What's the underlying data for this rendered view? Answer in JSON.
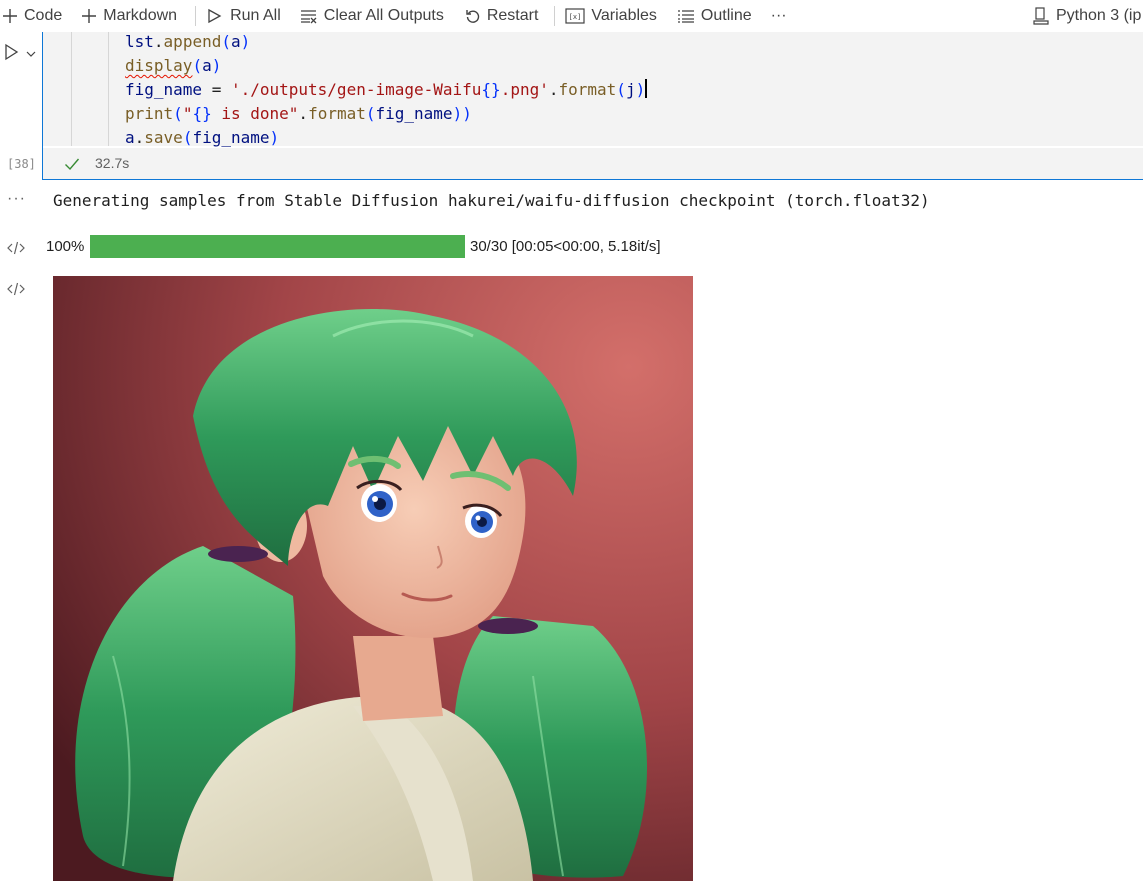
{
  "toolbar": {
    "code_label": "Code",
    "markdown_label": "Markdown",
    "run_all_label": "Run All",
    "clear_all_outputs_label": "Clear All Outputs",
    "restart_label": "Restart",
    "variables_label": "Variables",
    "outline_label": "Outline",
    "more_label": "···",
    "kernel_label": "Python 3 (ip"
  },
  "cell": {
    "code_lines": [
      "lst.append(a)",
      "display(a)",
      "fig_name = './outputs/gen-image-Waifu{}.png'.format(j)",
      "print(\"{} is done\".format(fig_name))",
      "a.save(fig_name)"
    ],
    "execution_count": "[38]",
    "duration": "32.7s",
    "status": "success"
  },
  "outputs": {
    "stream_text": "Generating samples from Stable Diffusion hakurei/waifu-diffusion checkpoint (torch.float32)",
    "progress_percent_label": "100%",
    "progress_fraction": 1.0,
    "progress_info": "30/30 [00:05<00:00, 5.18it/s]",
    "more_label": "···"
  },
  "colors": {
    "accent": "#0e77d6",
    "progress": "#4caf50",
    "success": "#388a34"
  }
}
